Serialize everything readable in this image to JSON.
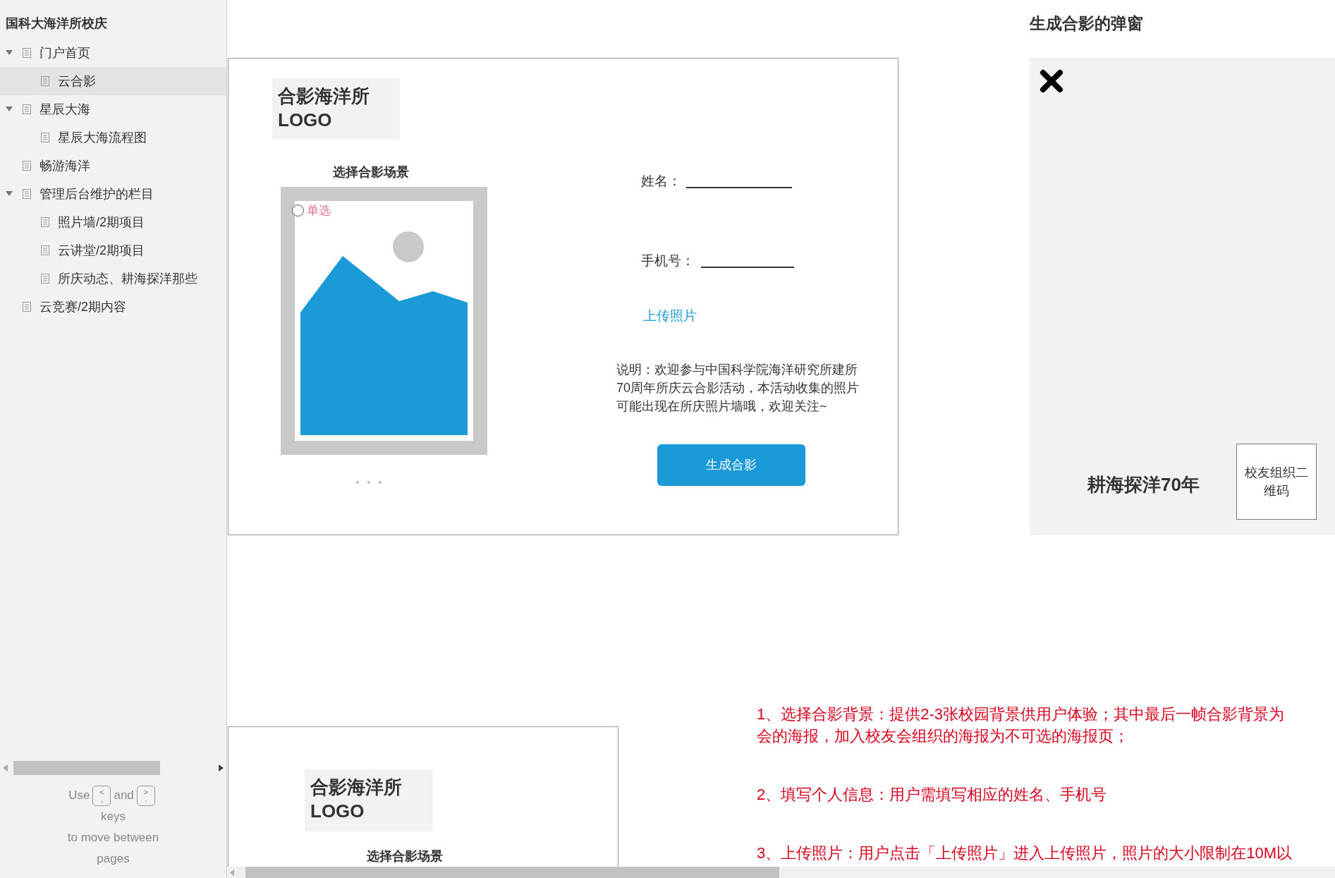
{
  "sidebar": {
    "title": "国科大海洋所校庆",
    "items": [
      {
        "label": "门户首页",
        "expanded": true,
        "selected": false,
        "children": [
          {
            "label": "云合影",
            "selected": true
          }
        ]
      },
      {
        "label": "星辰大海",
        "expanded": true,
        "selected": false,
        "children": [
          {
            "label": "星辰大海流程图",
            "selected": false
          }
        ]
      },
      {
        "label": "畅游海洋",
        "selected": false
      },
      {
        "label": "管理后台维护的栏目",
        "expanded": true,
        "selected": false,
        "children": [
          {
            "label": "照片墙/2期项目",
            "selected": false
          },
          {
            "label": "云讲堂/2期项目",
            "selected": false
          },
          {
            "label": "所庆动态、耕海探洋那些",
            "selected": false
          }
        ]
      },
      {
        "label": "云竞赛/2期内容",
        "selected": false
      }
    ],
    "hint": {
      "before": "Use",
      "key_prev": [
        "<",
        ","
      ],
      "middle": "and",
      "key_next": [
        ">",
        "."
      ],
      "line2": "keys",
      "line3": "to move between",
      "line4": "pages"
    }
  },
  "main_card": {
    "logo": [
      "合影海洋所",
      "LOGO"
    ],
    "scene_title": "选择合影场景",
    "radio": {
      "label": "单选",
      "selected": false
    },
    "pager_dots": "。。。",
    "name_label": "姓名：",
    "phone_label": "手机号：",
    "upload_link": "上传照片",
    "description": "说明：欢迎参与中国科学院海洋研究所建所70周年所庆云合影活动，本活动收集的照片可能出现在所庆照片墙哦，欢迎关注~",
    "button": "生成合影"
  },
  "popup": {
    "title": "生成合影的弹窗",
    "slogan": "耕海探洋70年",
    "qr_placeholder": "校友组织二维码"
  },
  "notes": [
    [
      "1、选择合影背景：提供2-3张校园背景供用户体验；其中最后一帧合影背景为",
      "会的海报，加入校友会组织的海报为不可选的海报页；"
    ],
    [
      "2、填写个人信息：用户需填写相应的姓名、手机号"
    ],
    [
      "3、上传照片：用户点击「上传照片」进入上传照片，照片的大小限制在10M以"
    ]
  ],
  "second_card": {
    "logo": [
      "合影海洋所",
      "LOGO"
    ],
    "scene_title": "选择合影场景"
  }
}
